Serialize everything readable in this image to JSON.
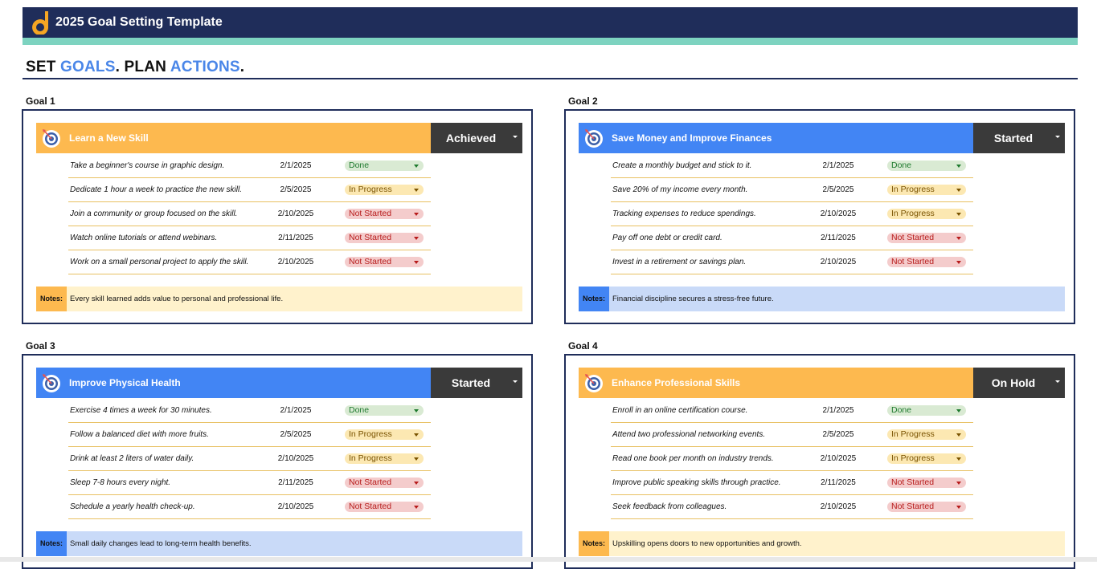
{
  "app": {
    "title": "2025 Goal Setting Template",
    "brand_color": "#1f2d5a",
    "stripe_color": "#7dd3c0"
  },
  "headline": {
    "part1": "SET ",
    "accent1": "GOALS",
    "part2": ". PLAN ",
    "accent2": "ACTIONS",
    "part3": "."
  },
  "goals": [
    {
      "label": "Goal 1",
      "title": "Learn a New Skill",
      "status": "Achieved",
      "theme": "orange",
      "tasks": [
        {
          "text": "Take a beginner's course in graphic design.",
          "date": "2/1/2025",
          "status": "Done"
        },
        {
          "text": "Dedicate 1 hour a week to practice the new skill.",
          "date": "2/5/2025",
          "status": "In Progress"
        },
        {
          "text": "Join a community or group focused on the skill.",
          "date": "2/10/2025",
          "status": "Not Started"
        },
        {
          "text": "Watch online tutorials or attend webinars.",
          "date": "2/11/2025",
          "status": "Not Started"
        },
        {
          "text": "Work on a small personal project to apply the skill.",
          "date": "2/10/2025",
          "status": "Not Started"
        }
      ],
      "notes_label": "Notes:",
      "notes": "Every skill learned adds value to personal and professional life."
    },
    {
      "label": "Goal 2",
      "title": "Save Money and Improve Finances",
      "status": "Started",
      "theme": "blue",
      "tasks": [
        {
          "text": "Create a monthly budget and stick to it.",
          "date": "2/1/2025",
          "status": "Done"
        },
        {
          "text": "Save 20% of my income every month.",
          "date": "2/5/2025",
          "status": "In Progress"
        },
        {
          "text": "Tracking expenses to reduce spendings.",
          "date": "2/10/2025",
          "status": "In Progress"
        },
        {
          "text": "Pay off one debt or credit card.",
          "date": "2/11/2025",
          "status": "Not Started"
        },
        {
          "text": "Invest in a retirement or savings plan.",
          "date": "2/10/2025",
          "status": "Not Started"
        }
      ],
      "notes_label": "Notes:",
      "notes": "Financial discipline secures a stress-free future."
    },
    {
      "label": "Goal 3",
      "title": "Improve Physical Health",
      "status": "Started",
      "theme": "blue",
      "tasks": [
        {
          "text": "Exercise 4 times a week for 30 minutes.",
          "date": "2/1/2025",
          "status": "Done"
        },
        {
          "text": "Follow a balanced diet with more fruits.",
          "date": "2/5/2025",
          "status": "In Progress"
        },
        {
          "text": "Drink at least 2 liters of water daily.",
          "date": "2/10/2025",
          "status": "In Progress"
        },
        {
          "text": "Sleep 7-8 hours every night.",
          "date": "2/11/2025",
          "status": "Not Started"
        },
        {
          "text": "Schedule a yearly health check-up.",
          "date": "2/10/2025",
          "status": "Not Started"
        }
      ],
      "notes_label": "Notes:",
      "notes": "Small daily changes lead to long-term health benefits."
    },
    {
      "label": "Goal 4",
      "title": "Enhance Professional Skills",
      "status": "On Hold",
      "theme": "orange",
      "tasks": [
        {
          "text": "Enroll in an online certification course.",
          "date": "2/1/2025",
          "status": "Done"
        },
        {
          "text": "Attend two professional networking events.",
          "date": "2/5/2025",
          "status": "In Progress"
        },
        {
          "text": "Read one book per month on industry trends.",
          "date": "2/10/2025",
          "status": "In Progress"
        },
        {
          "text": "Improve public speaking skills through practice.",
          "date": "2/11/2025",
          "status": "Not Started"
        },
        {
          "text": "Seek feedback from colleagues.",
          "date": "2/10/2025",
          "status": "Not Started"
        }
      ],
      "notes_label": "Notes:",
      "notes": "Upskilling opens doors to new opportunities and growth."
    }
  ]
}
